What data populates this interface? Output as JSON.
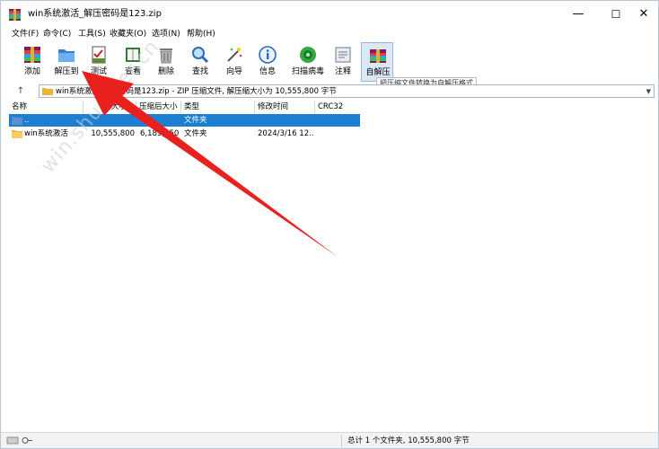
{
  "window": {
    "title": "win系统激活_解压密码是123.zip",
    "controls": {
      "minimize": "—",
      "maximize": "☐",
      "close": "✕"
    }
  },
  "menu": [
    "文件(F)",
    "命令(C)",
    "工具(S)",
    "收藏夹(O)",
    "选项(N)",
    "帮助(H)"
  ],
  "toolbar": [
    {
      "label": "添加",
      "icon": "add-archive-icon"
    },
    {
      "label": "解压到",
      "icon": "extract-to-folder-icon"
    },
    {
      "label": "测试",
      "icon": "test-checklist-icon"
    },
    {
      "label": "查看",
      "icon": "view-book-icon"
    },
    {
      "label": "删除",
      "icon": "trash-can-icon"
    },
    {
      "label": "查找",
      "icon": "find-magnifier-icon"
    },
    {
      "label": "向导",
      "icon": "wizard-wand-icon"
    },
    {
      "label": "信息",
      "icon": "info-icon"
    },
    {
      "label": "扫描病毒",
      "icon": "virus-scan-icon"
    },
    {
      "label": "注释",
      "icon": "comment-icon"
    },
    {
      "label": "自解压",
      "icon": "sfx-archive-icon"
    }
  ],
  "tooltip": "把压缩文件转换为自解压格式",
  "address": {
    "text": "win系统激活_解压密码是123.zip - ZIP 压缩文件, 解压缩大小为 10,555,800 字节"
  },
  "columns": [
    "名称",
    "大小",
    "压缩后大小",
    "类型",
    "修改时间",
    "CRC32"
  ],
  "rows": [
    {
      "name": "..",
      "size": "",
      "packed": "",
      "type": "文件夹",
      "modified": "",
      "crc": ""
    },
    {
      "name": "win系统激活",
      "size": "10,555,800",
      "packed": "6,189,750",
      "type": "文件夹",
      "modified": "2024/3/16 12...",
      "crc": ""
    }
  ],
  "status": {
    "text": "总计 1 个文件夹, 10,555,800 字节"
  },
  "watermark": "win.shupiner.cn",
  "colors": {
    "selection": "#1c7fd2",
    "arrow": "#e8211f"
  }
}
